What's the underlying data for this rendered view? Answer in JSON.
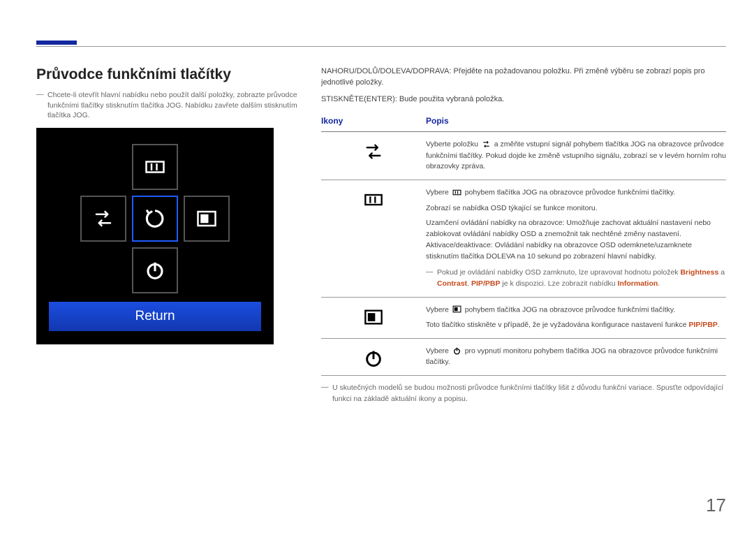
{
  "page_number": "17",
  "heading": "Průvodce funkčními tlačítky",
  "left_note": "Chcete-li otevřít hlavní nabídku nebo použít další položky, zobrazte průvodce funkčními tlačítky stisknutím tlačítka JOG. Nabídku zavřete dalším stisknutím tlačítka JOG.",
  "panel": {
    "return_label": "Return"
  },
  "right_intro": {
    "p1": "NAHORU/DOLŮ/DOLEVA/DOPRAVA: Přejděte na požadovanou položku. Při změně výběru se zobrazí popis pro jednotlivé položky.",
    "p2": "STISKNĚTE(ENTER): Bude použita vybraná položka."
  },
  "table": {
    "headers": {
      "icons": "Ikony",
      "desc": "Popis"
    },
    "rows": [
      {
        "icon": "source-icon",
        "desc_parts": {
          "pre": "Vyberte položku ",
          "post": " a změňte vstupní signál pohybem tlačítka JOG na obrazovce průvodce funkčními tlačítky. Pokud dojde ke změně vstupního signálu, zobrazí se v levém horním rohu obrazovky zpráva."
        }
      },
      {
        "icon": "menu-icon",
        "desc_parts": {
          "p1_pre": "Vybere ",
          "p1_post": " pohybem tlačítka JOG na obrazovce průvodce funkčními tlačítky.",
          "p2": "Zobrazí se nabídka OSD týkající se funkce monitoru.",
          "p3": "Uzamčení ovládání nabídky na obrazovce: Umožňuje zachovat aktuální nastavení nebo zablokovat ovládání nabídky OSD a znemožnit tak nechtěné změny nastavení. Aktivace/deaktivace: Ovládání nabídky na obrazovce OSD odemknete/uzamknete stisknutím tlačítka DOLEVA na 10 sekund po zobrazení hlavní nabídky.",
          "note_pre": "Pokud je ovládání nabídky OSD zamknuto, lze upravovat hodnotu položek ",
          "kw1": "Brightness",
          "note_mid": " a ",
          "kw2": "Contrast",
          "note_mid2": ". ",
          "kw3": "PIP/PBP",
          "note_mid3": " je k dispozici. Lze zobrazit nabídku ",
          "kw4": "Information",
          "note_post": "."
        }
      },
      {
        "icon": "pip-icon",
        "desc_parts": {
          "p1_pre": "Vybere ",
          "p1_post": " pohybem tlačítka JOG na obrazovce průvodce funkčními tlačítky.",
          "p2_pre": "Toto tlačítko stiskněte v případě, že je vyžadována konfigurace nastavení funkce ",
          "kw": "PIP/PBP",
          "p2_post": "."
        }
      },
      {
        "icon": "power-icon",
        "desc_parts": {
          "pre": "Vybere ",
          "post": " pro vypnutí monitoru pohybem tlačítka JOG na obrazovce průvodce funkčními tlačítky."
        }
      }
    ],
    "footnote": "U skutečných modelů se budou možnosti průvodce funkčními tlačítky lišit z důvodu funkční variace. Spusťte odpovídající funkci na základě aktuální ikony a popisu."
  }
}
